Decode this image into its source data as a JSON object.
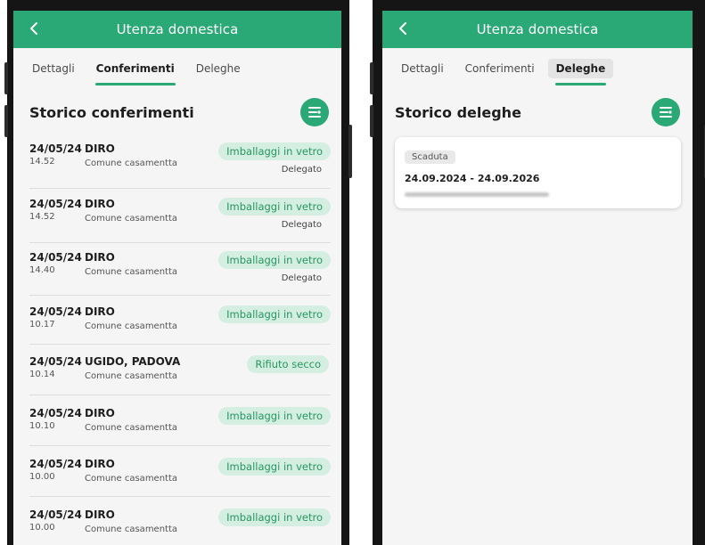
{
  "left": {
    "appbar": {
      "title": "Utenza domestica",
      "back_icon": "chevron-left-icon"
    },
    "tabs": [
      {
        "label": "Dettagli",
        "active": false
      },
      {
        "label": "Conferimenti",
        "active": true
      },
      {
        "label": "Deleghe",
        "active": false
      }
    ],
    "section_title": "Storico conferimenti",
    "filter_icon": "filter-list-icon",
    "rows": [
      {
        "date": "24/05/24",
        "time": "14.52",
        "place": "DIRO",
        "commune": "Comune casamentta",
        "material": "Imballaggi in vetro",
        "delegate": "Delegato"
      },
      {
        "date": "24/05/24",
        "time": "14.52",
        "place": "DIRO",
        "commune": "Comune casamentta",
        "material": "Imballaggi in vetro",
        "delegate": "Delegato"
      },
      {
        "date": "24/05/24",
        "time": "14.40",
        "place": "DIRO",
        "commune": "Comune casamentta",
        "material": "Imballaggi in vetro",
        "delegate": "Delegato"
      },
      {
        "date": "24/05/24",
        "time": "10.17",
        "place": "DIRO",
        "commune": "Comune casamentta",
        "material": "Imballaggi in vetro",
        "delegate": ""
      },
      {
        "date": "24/05/24",
        "time": "10.14",
        "place": "UGIDO, PADOVA",
        "commune": "Comune casamentta",
        "material": "Rifiuto secco",
        "delegate": ""
      },
      {
        "date": "24/05/24",
        "time": "10.10",
        "place": "DIRO",
        "commune": "Comune casamentta",
        "material": "Imballaggi in vetro",
        "delegate": ""
      },
      {
        "date": "24/05/24",
        "time": "10.00",
        "place": "DIRO",
        "commune": "Comune casamentta",
        "material": "Imballaggi in vetro",
        "delegate": ""
      },
      {
        "date": "24/05/24",
        "time": "10.00",
        "place": "DIRO",
        "commune": "Comune casamentta",
        "material": "Imballaggi in vetro",
        "delegate": ""
      }
    ]
  },
  "right": {
    "appbar": {
      "title": "Utenza domestica",
      "back_icon": "chevron-left-icon"
    },
    "tabs": [
      {
        "label": "Dettagli",
        "active": false
      },
      {
        "label": "Conferimenti",
        "active": false
      },
      {
        "label": "Deleghe",
        "active": true
      }
    ],
    "section_title": "Storico deleghe",
    "filter_icon": "filter-list-icon",
    "card": {
      "status": "Scaduta",
      "range": "24.09.2024 - 24.09.2026"
    }
  },
  "colors": {
    "brand_green": "#2aa876",
    "chip_bg": "#d4eee2",
    "chip_text": "#27965f",
    "screen_bg": "#f5f5f5"
  }
}
